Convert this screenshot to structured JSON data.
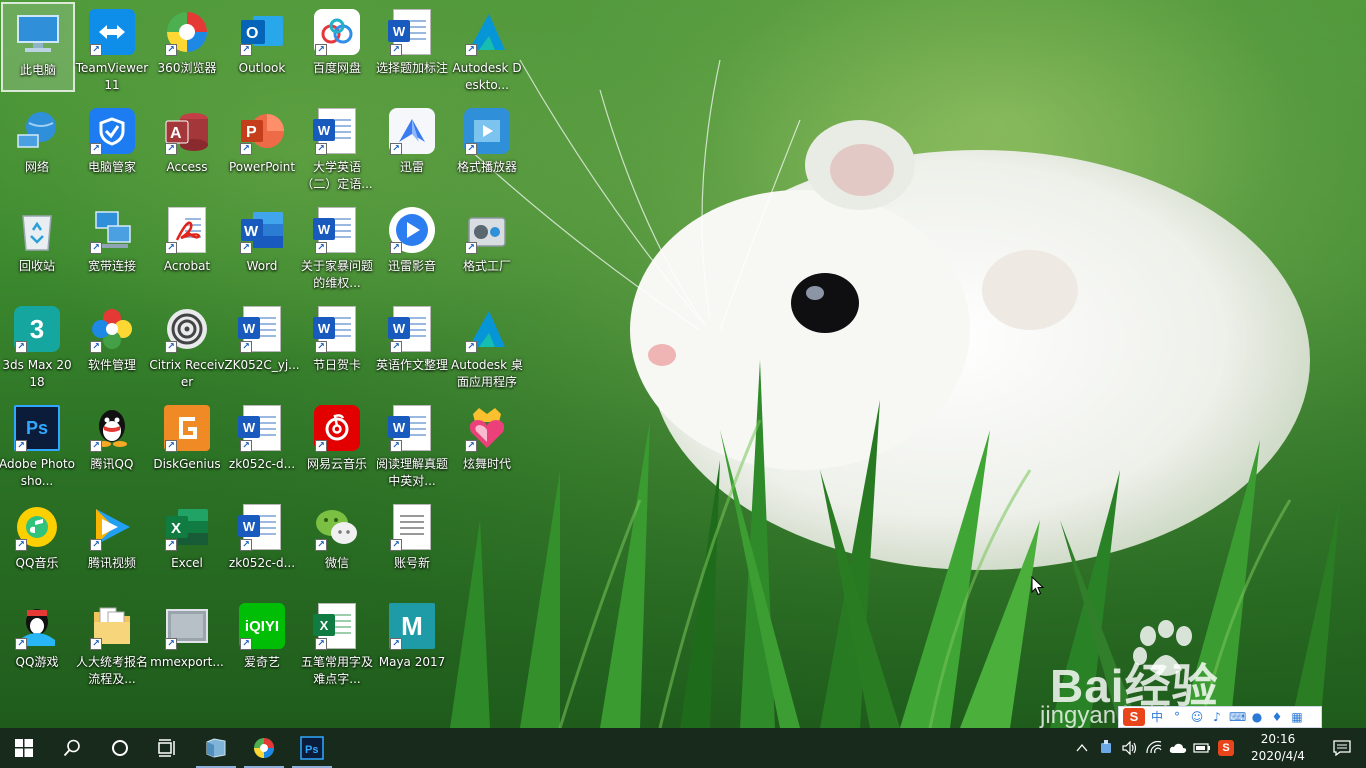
{
  "desktop": {
    "icons": [
      {
        "label": "此电脑",
        "icon": "this-pc-icon"
      },
      {
        "label": "TeamViewer 11",
        "icon": "teamviewer-icon"
      },
      {
        "label": "360浏览器",
        "icon": "360-browser-icon"
      },
      {
        "label": "Outlook",
        "icon": "outlook-icon"
      },
      {
        "label": "百度网盘",
        "icon": "baidu-netdisk-icon"
      },
      {
        "label": "选择题加标注",
        "icon": "word-doc-icon"
      },
      {
        "label": "Autodesk Deskto...",
        "icon": "autodesk-icon"
      },
      {
        "label": "网络",
        "icon": "network-icon"
      },
      {
        "label": "电脑管家",
        "icon": "pc-manager-icon"
      },
      {
        "label": "Access",
        "icon": "access-icon"
      },
      {
        "label": "PowerPoint",
        "icon": "powerpoint-icon"
      },
      {
        "label": "大学英语（二）定语...",
        "icon": "word-doc-icon"
      },
      {
        "label": "迅雷",
        "icon": "xunlei-icon"
      },
      {
        "label": "格式播放器",
        "icon": "format-player-icon"
      },
      {
        "label": "回收站",
        "icon": "recycle-bin-icon"
      },
      {
        "label": "宽带连接",
        "icon": "broadband-icon"
      },
      {
        "label": "Acrobat",
        "icon": "acrobat-icon"
      },
      {
        "label": "Word",
        "icon": "word-icon"
      },
      {
        "label": "关于家暴问题的维权...",
        "icon": "word-doc-icon"
      },
      {
        "label": "迅雷影音",
        "icon": "xunlei-player-icon"
      },
      {
        "label": "格式工厂",
        "icon": "format-factory-icon"
      },
      {
        "label": "3ds Max 2018",
        "icon": "3dsmax-icon"
      },
      {
        "label": "软件管理",
        "icon": "software-manager-icon"
      },
      {
        "label": "Citrix Receiver",
        "icon": "citrix-icon"
      },
      {
        "label": "ZK052C_yj...",
        "icon": "word-doc-icon"
      },
      {
        "label": "节日贺卡",
        "icon": "word-doc-icon"
      },
      {
        "label": "英语作文整理",
        "icon": "word-doc-icon"
      },
      {
        "label": "Autodesk 桌面应用程序",
        "icon": "autodesk-icon"
      },
      {
        "label": "Adobe Photosho...",
        "icon": "photoshop-icon"
      },
      {
        "label": "腾讯QQ",
        "icon": "qq-icon"
      },
      {
        "label": "DiskGenius",
        "icon": "diskgenius-icon"
      },
      {
        "label": "zk052c-d...",
        "icon": "word-doc-icon"
      },
      {
        "label": "网易云音乐",
        "icon": "netease-music-icon"
      },
      {
        "label": "阅读理解真题中英对...",
        "icon": "word-doc-icon"
      },
      {
        "label": "炫舞时代",
        "icon": "dance-game-icon"
      },
      {
        "label": "QQ音乐",
        "icon": "qq-music-icon"
      },
      {
        "label": "腾讯视频",
        "icon": "tencent-video-icon"
      },
      {
        "label": "Excel",
        "icon": "excel-icon"
      },
      {
        "label": "zk052c-d...",
        "icon": "word-doc-icon"
      },
      {
        "label": "微信",
        "icon": "wechat-icon"
      },
      {
        "label": "账号新",
        "icon": "text-file-icon"
      },
      {
        "label": "QQ游戏",
        "icon": "qq-game-icon"
      },
      {
        "label": "人大统考报名流程及...",
        "icon": "folder-docs-icon"
      },
      {
        "label": "mmexport...",
        "icon": "image-file-icon"
      },
      {
        "label": "爱奇艺",
        "icon": "iqiyi-icon"
      },
      {
        "label": "五笔常用字及难点字...",
        "icon": "excel-doc-icon"
      },
      {
        "label": "Maya 2017",
        "icon": "maya-icon"
      }
    ]
  },
  "watermark": {
    "brand": "Bai经验",
    "url": "jingyan.baidu.com"
  },
  "ime": {
    "logo": "S",
    "mode": "中"
  },
  "taskbar": {
    "start_icon": "windows-start-icon",
    "search_icon": "search-icon",
    "cortana_icon": "cortana-icon",
    "taskview_icon": "task-view-icon",
    "pinned": [
      "file-explorer-icon",
      "360-browser-icon",
      "photoshop-icon"
    ],
    "tray": {
      "time": "20:16",
      "date": "2020/4/4",
      "ime_char": "S"
    }
  },
  "colors": {
    "taskbar": "#182a1c",
    "accent": "#185abd"
  }
}
